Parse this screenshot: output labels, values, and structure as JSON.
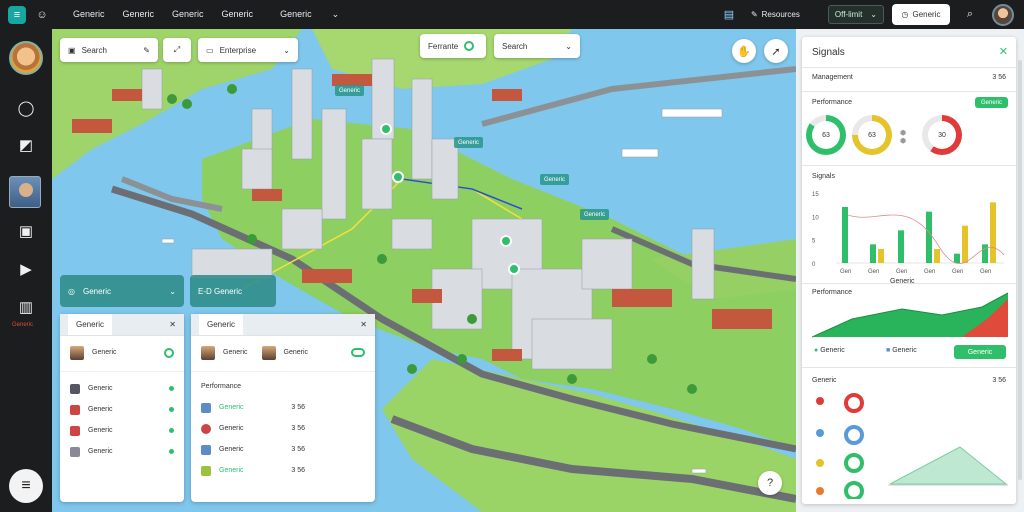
{
  "topbar": {
    "nav": [
      "Generic",
      "Generic",
      "Generic",
      "Generic",
      "Generic"
    ],
    "chip_label": "Resources",
    "select_value": "Off-limit",
    "button_label": "Generic"
  },
  "sidebar": {
    "label": "Generic"
  },
  "map": {
    "toolbar": {
      "search_label": "Search",
      "filter_label": "Enterprise",
      "layer_label": "Ferrante",
      "layer_select": "Search"
    },
    "labels": [
      "Generic",
      "Generic",
      "Generic",
      "Generic"
    ],
    "teal_left": "Generic",
    "teal_right": "E-D Generic"
  },
  "left_panel": {
    "tab": "Generic",
    "items": [
      {
        "label": "Generic"
      },
      {
        "label": "Generic"
      },
      {
        "label": "Generic"
      },
      {
        "label": "Generic"
      },
      {
        "label": "Generic"
      }
    ]
  },
  "mid_panel": {
    "tab": "Generic",
    "people": [
      "Generic",
      "Generic"
    ],
    "section": "Performance",
    "rows": [
      {
        "label": "Generic",
        "value": "3 56"
      },
      {
        "label": "Generic",
        "value": "3 56"
      },
      {
        "label": "Generic",
        "value": "3 56"
      },
      {
        "label": "Generic",
        "value": "3 56"
      }
    ]
  },
  "right_panel": {
    "title": "Signals",
    "subtitle": "Management",
    "subtitle_value": "3 56",
    "donut_section": "Performance",
    "donut_badge": "Generic",
    "donuts": [
      {
        "label": "63",
        "color": "#2fbf6b",
        "fraction": 0.85
      },
      {
        "label": "63",
        "color": "#e5c32a",
        "fraction": 0.75
      },
      {
        "label": "30",
        "color": "#e03a3a",
        "fraction": 0.6
      }
    ],
    "bar_section": "Signals",
    "bar_axis": [
      "15",
      "10",
      "5",
      "0"
    ],
    "bar_categories": [
      "Gen",
      "Gen",
      "Gen",
      "Gen",
      "Gen",
      "Gen"
    ],
    "area_section": "Performance",
    "area_value": "Generic",
    "legend_one": "Generic",
    "legend_two": "Generic",
    "button_label": "Generic",
    "bottom_section": "Generic",
    "bottom_value": "3 56"
  },
  "colors": {
    "accent": "#2fbf6b",
    "dark": "#1b1d1f",
    "teal": "#2d8c87",
    "water": "#7fc7ec"
  },
  "chart_data": {
    "type": "bar",
    "categories": [
      "",
      "",
      "",
      "",
      "",
      ""
    ],
    "series": [
      {
        "values": [
          12,
          4,
          7,
          11,
          2,
          4
        ]
      },
      {
        "values": [
          0,
          3,
          0,
          3,
          8,
          13
        ]
      }
    ],
    "ylim": [
      0,
      15
    ]
  }
}
